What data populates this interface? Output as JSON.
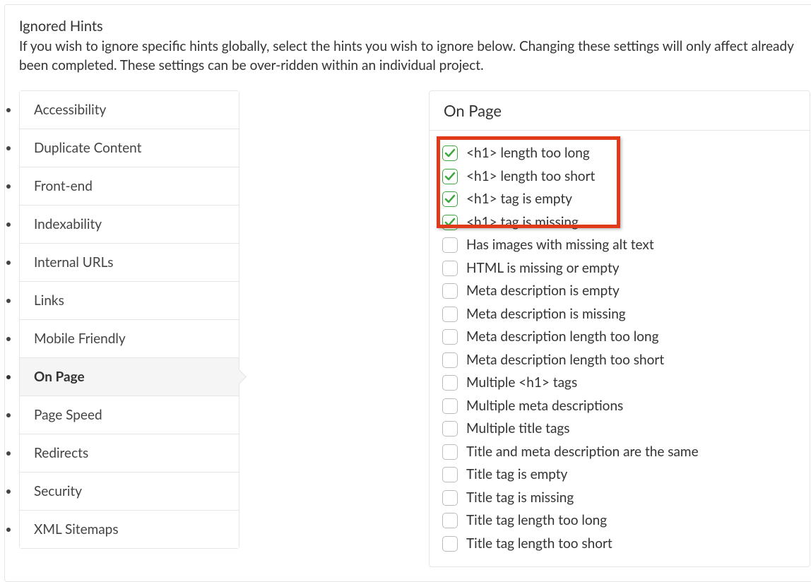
{
  "header": {
    "title": "Ignored Hints",
    "description": "If you wish to ignore specific hints globally, select the hints you wish to ignore below. Changing these settings will only affect already been completed. These settings can be over-ridden within an individual project."
  },
  "sidebar": {
    "items": [
      {
        "label": "Accessibility",
        "active": false
      },
      {
        "label": "Duplicate Content",
        "active": false
      },
      {
        "label": "Front-end",
        "active": false
      },
      {
        "label": "Indexability",
        "active": false
      },
      {
        "label": "Internal URLs",
        "active": false
      },
      {
        "label": "Links",
        "active": false
      },
      {
        "label": "Mobile Friendly",
        "active": false
      },
      {
        "label": "On Page",
        "active": true
      },
      {
        "label": "Page Speed",
        "active": false
      },
      {
        "label": "Redirects",
        "active": false
      },
      {
        "label": "Security",
        "active": false
      },
      {
        "label": "XML Sitemaps",
        "active": false
      }
    ]
  },
  "panel": {
    "title": "On Page",
    "hints": [
      {
        "label": "<h1> length too long",
        "checked": true
      },
      {
        "label": "<h1> length too short",
        "checked": true
      },
      {
        "label": "<h1> tag is empty",
        "checked": true
      },
      {
        "label": "<h1> tag is missing",
        "checked": true
      },
      {
        "label": "Has images with missing alt text",
        "checked": false
      },
      {
        "label": "HTML is missing or empty",
        "checked": false
      },
      {
        "label": "Meta description is empty",
        "checked": false
      },
      {
        "label": "Meta description is missing",
        "checked": false
      },
      {
        "label": "Meta description length too long",
        "checked": false
      },
      {
        "label": "Meta description length too short",
        "checked": false
      },
      {
        "label": "Multiple <h1> tags",
        "checked": false
      },
      {
        "label": "Multiple meta descriptions",
        "checked": false
      },
      {
        "label": "Multiple title tags",
        "checked": false
      },
      {
        "label": "Title and meta description are the same",
        "checked": false
      },
      {
        "label": "Title tag is empty",
        "checked": false
      },
      {
        "label": "Title tag is missing",
        "checked": false
      },
      {
        "label": "Title tag length too long",
        "checked": false
      },
      {
        "label": "Title tag length too short",
        "checked": false
      }
    ]
  },
  "colors": {
    "highlight": "#e03a1b",
    "check_green": "#3fa63f"
  }
}
